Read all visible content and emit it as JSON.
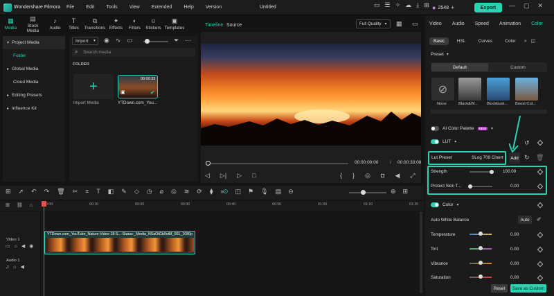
{
  "app": {
    "name": "Wondershare Filmora",
    "project_title": "Untitled",
    "credits": "2548"
  },
  "menu": [
    "File",
    "Edit",
    "Tools",
    "View",
    "Extended",
    "Help",
    "Version"
  ],
  "export_label": "Export",
  "media_tabs": [
    {
      "label": "Media",
      "icon": "media-icon"
    },
    {
      "label": "Stock Media",
      "icon": "stock-media-icon"
    },
    {
      "label": "Audio",
      "icon": "music-note-icon"
    },
    {
      "label": "Titles",
      "icon": "text-icon"
    },
    {
      "label": "Transitions",
      "icon": "transitions-icon"
    },
    {
      "label": "Effects",
      "icon": "effects-icon"
    },
    {
      "label": "Filters",
      "icon": "filters-icon"
    },
    {
      "label": "Stickers",
      "icon": "stickers-icon"
    },
    {
      "label": "Templates",
      "icon": "templates-icon"
    }
  ],
  "sidebar": {
    "items": [
      "Project Media",
      "Folder",
      "Global Media",
      "Cloud Media",
      "Editing Presets",
      "Influence Kit"
    ]
  },
  "media": {
    "import_label": "Import",
    "search_placeholder": "Search media",
    "folder_label": "FOLDER",
    "import_media_label": "Import Media",
    "clip_duration": "00:00:33",
    "clip_name": "YTDown.com_You..."
  },
  "preview": {
    "tab_timeline": "Timeline",
    "tab_source": "Source",
    "quality": "Full Quality",
    "current_time": "00:00:00:00",
    "separator": "/",
    "total_time": "00:00:33:08"
  },
  "ruler_ticks": [
    "00:00",
    "00:10",
    "00:20",
    "00:30",
    "00:40",
    "00:50",
    "01:00",
    "01:10",
    "01:20"
  ],
  "tracks": {
    "video_label": "Video 1",
    "audio_label": "Audio 1"
  },
  "timeline_clip_name": "YTDown.com_YouTube_Nature-Video-18-S...-Status-_Media_NSaOtGb9otM_001_1080p",
  "right_panel": {
    "tabs": [
      "Video",
      "Audio",
      "Speed",
      "Animation",
      "Color"
    ],
    "subtabs": [
      "Basic",
      "HSL",
      "Curves",
      "Color"
    ],
    "preset_label": "Preset",
    "preset_segments": [
      "Default",
      "Custom"
    ],
    "presets": [
      "None",
      "Black&W...",
      "Blockbust...",
      "Boost Col..."
    ],
    "ai_palette": "AI Color Palette",
    "ai_badge": "NEW",
    "lut_label": "LUT",
    "lut_preset_label": "Lut Preset",
    "lut_preset_value": "SLog 709 Cinem...",
    "add_label": "Add",
    "strength": {
      "label": "Strength",
      "value": "100.00",
      "level": 1.0
    },
    "protect_skin": {
      "label": "Protect Skin T...",
      "value": "0.00",
      "level": 0.0
    },
    "color_label": "Color",
    "awb_label": "Auto White Balance",
    "auto_label": "Auto",
    "color_rows": [
      {
        "label": "Temperature",
        "value": "0.00"
      },
      {
        "label": "Tint",
        "value": "0.00"
      },
      {
        "label": "Vibrance",
        "value": "0.00"
      },
      {
        "label": "Saturation",
        "value": "0.00"
      }
    ],
    "reset_label": "Reset",
    "save_label": "Save as Custom"
  },
  "colors": {
    "accent": "#2cd2b1",
    "playhead": "#e84f4f"
  }
}
